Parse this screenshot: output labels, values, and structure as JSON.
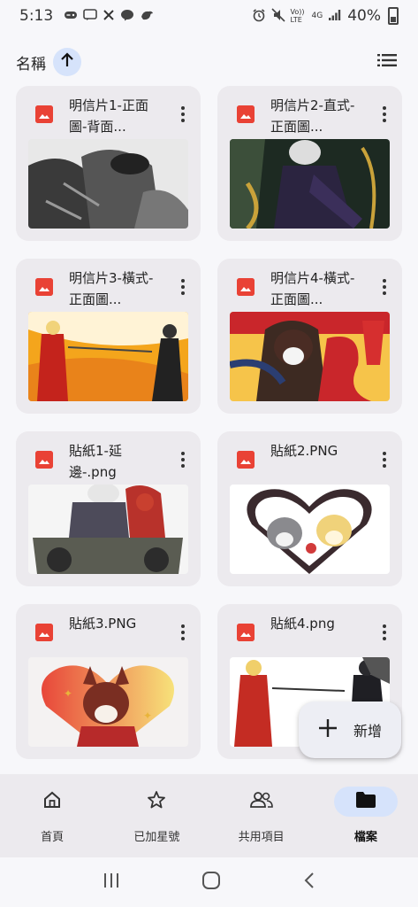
{
  "status_bar": {
    "time": "5:13",
    "network_label": "Vo)) LTE",
    "network_type": "4G",
    "battery": "40%"
  },
  "sort_bar": {
    "label": "名稱",
    "direction_icon": "arrow-up-icon",
    "view_icon": "list-view-icon"
  },
  "files": [
    {
      "name": "明信片1-正面圖-背面...",
      "type": "image",
      "thumb": "mono-illustration"
    },
    {
      "name": "明信片2-直式-正面圖...",
      "type": "image",
      "thumb": "dark-suit-illustration"
    },
    {
      "name": "明信片3-橫式-正面圖...",
      "type": "image",
      "thumb": "orange-gunfight"
    },
    {
      "name": "明信片4-橫式-正面圖...",
      "type": "image",
      "thumb": "new-year-snake"
    },
    {
      "name": "貼紙1-延邊-.png",
      "type": "image",
      "thumb": "motorbike-duo"
    },
    {
      "name": "貼紙2.PNG",
      "type": "image",
      "thumb": "heart-cats"
    },
    {
      "name": "貼紙3.PNG",
      "type": "image",
      "thumb": "heart-fox"
    },
    {
      "name": "貼紙4.png",
      "type": "image",
      "thumb": "red-coat-gunfight"
    }
  ],
  "fab": {
    "label": "新增",
    "icon": "plus-icon"
  },
  "bottom_nav": [
    {
      "label": "首頁",
      "icon": "home-icon",
      "active": false
    },
    {
      "label": "已加星號",
      "icon": "star-icon",
      "active": false
    },
    {
      "label": "共用項目",
      "icon": "people-icon",
      "active": false
    },
    {
      "label": "檔案",
      "icon": "folder-icon",
      "active": true
    }
  ],
  "colors": {
    "accent": "#d6e3fb",
    "file_icon": "#e94235",
    "card": "#eceaee",
    "background": "#f7f7fa"
  }
}
